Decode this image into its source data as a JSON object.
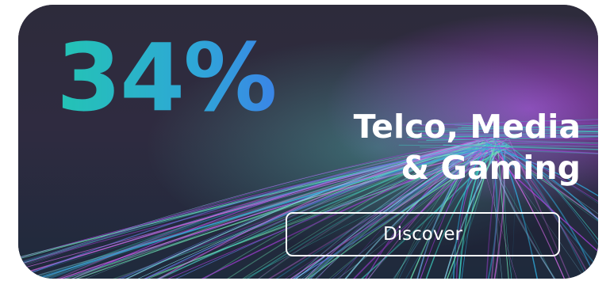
{
  "promo": {
    "stat": "34%",
    "title_line1": "Telco, Media",
    "title_line2": "& Gaming",
    "button_label": "Discover"
  },
  "colors": {
    "card_background": "#2c2a3c",
    "stat_gradient_start": "#23c4b4",
    "stat_gradient_end": "#3a85e6",
    "text": "#ffffff",
    "streak_purple": "#a13fd6",
    "streak_teal": "#3fd3c4"
  }
}
